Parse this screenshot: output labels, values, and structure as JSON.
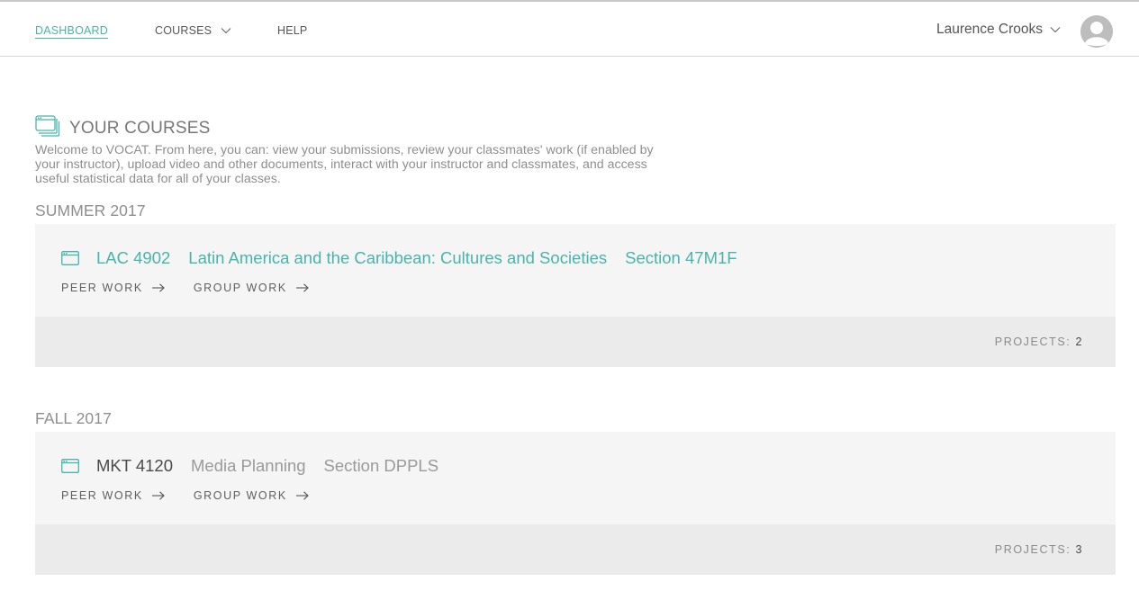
{
  "nav": {
    "items": [
      {
        "label": "DASHBOARD",
        "active": true
      },
      {
        "label": "COURSES",
        "has_dropdown": true
      },
      {
        "label": "HELP"
      }
    ],
    "user_name": "Laurence Crooks",
    "avatar_icon": "default-user-avatar"
  },
  "section": {
    "icon": "courses-stack-icon",
    "title": "YOUR COURSES",
    "intro": "Welcome to VOCAT. From here, you can: view your submissions, review your classmates' work (if enabled by your instructor), upload video and other documents, interact with your instructor and classmates, and access useful statistical data for all of your classes."
  },
  "terms": [
    {
      "label": "SUMMER 2017",
      "courses": [
        {
          "icon": "course-window-icon",
          "code": "LAC 4902",
          "name": "Latin America and the Caribbean: Cultures and Societies",
          "section": "Section 47M1F",
          "links": [
            "PEER WORK",
            "GROUP WORK"
          ],
          "projects_label": "PROJECTS:",
          "projects_count": "2"
        }
      ]
    },
    {
      "label": "FALL 2017",
      "courses": [
        {
          "icon": "course-window-icon",
          "code": "MKT 4120",
          "name": "Media Planning",
          "section": "Section DPPLS",
          "links": [
            "PEER WORK",
            "GROUP WORK"
          ],
          "projects_label": "PROJECTS:",
          "projects_count": "3"
        }
      ]
    }
  ],
  "colors": {
    "accent": "#47b5ac",
    "card_body": "#f5f5f5",
    "card_footer": "#ebebeb"
  }
}
